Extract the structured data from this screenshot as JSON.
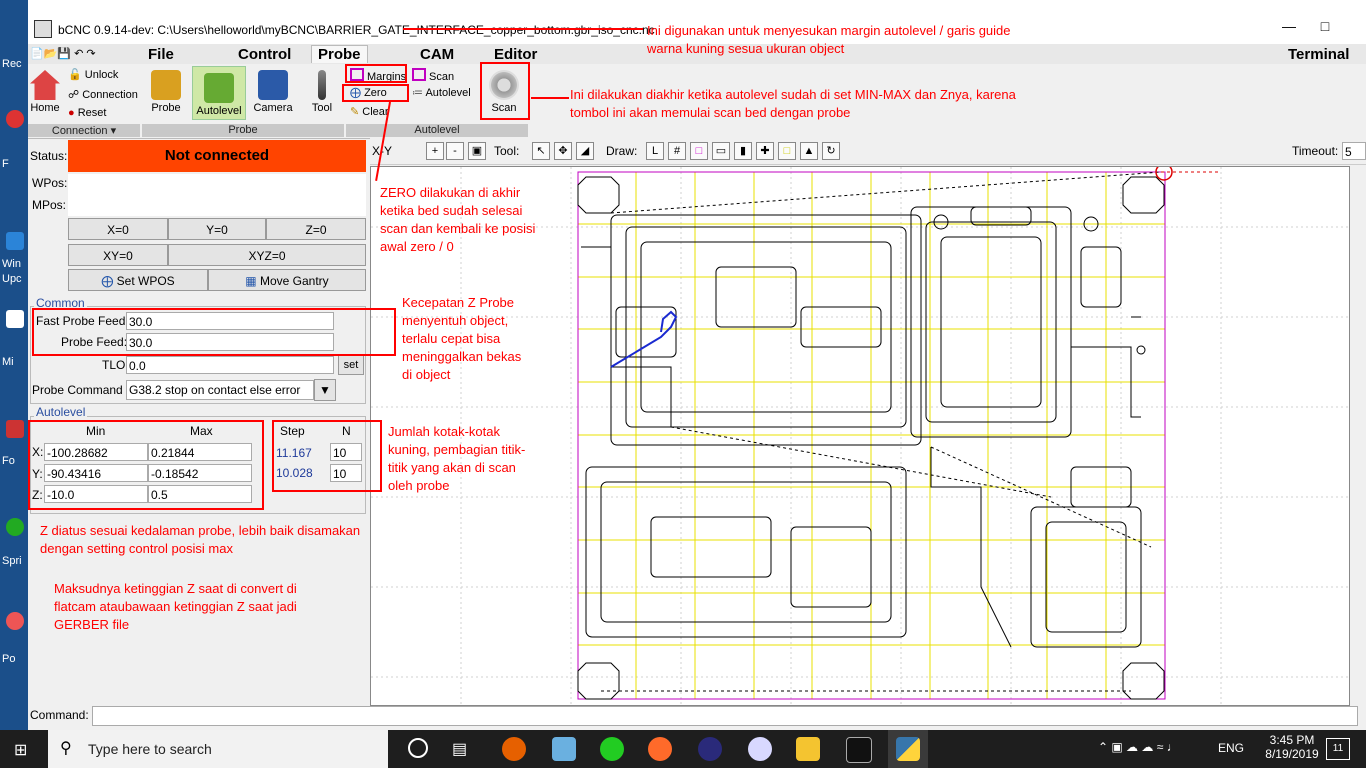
{
  "window": {
    "title": "bCNC 0.9.14-dev: C:\\Users\\helloworld\\myBCNC\\BARRIER_GATE_INTERFACE_copper_bottom.gbr_iso_cnc.nc",
    "min_icon": "minimize-icon",
    "max_icon": "maximize-icon"
  },
  "menubar": {
    "tabs": [
      "File",
      "Control",
      "Probe",
      "CAM",
      "Editor"
    ],
    "terminal": "Terminal"
  },
  "ribbon": {
    "connection": {
      "unlock": "Unlock",
      "connection": "Connection",
      "reset": "Reset",
      "home": "Home",
      "group": "Connection ▾"
    },
    "probe_group": {
      "probe": "Probe",
      "autolevel": "Autolevel",
      "camera": "Camera",
      "tool": "Tool",
      "group": "Probe"
    },
    "autolevel_group": {
      "margins": "Margins",
      "zero": "Zero",
      "clear": "Clear",
      "scan_small": "Scan",
      "autolevel_small": "Autolevel",
      "scan_big": "Scan",
      "group": "Autolevel"
    }
  },
  "left": {
    "status_label": "Status:",
    "status_value": "Not connected",
    "status_color": "#ff4400",
    "wpos_label": "WPos:",
    "mpos_label": "MPos:",
    "buttons": {
      "x0": "X=0",
      "y0": "Y=0",
      "z0": "Z=0",
      "xy0": "XY=0",
      "xyz0": "XYZ=0",
      "set_wpos": "Set WPOS",
      "move_gantry": "Move Gantry"
    },
    "common": {
      "title": "Common",
      "fast_probe_label": "Fast Probe Feed:",
      "fast_probe_value": "30.0",
      "probe_feed_label": "Probe Feed:",
      "probe_feed_value": "30.0",
      "tlo_label": "TLO",
      "tlo_value": "0.0",
      "set": "set",
      "probe_cmd_label": "Probe Command",
      "probe_cmd_value": "G38.2 stop on contact else error"
    },
    "autolevel": {
      "title": "Autolevel",
      "min": "Min",
      "max": "Max",
      "step": "Step",
      "n": "N",
      "x_label": "X:",
      "y_label": "Y:",
      "z_label": "Z:",
      "x_min": "-100.28682",
      "x_max": "0.21844",
      "y_min": "-90.43416",
      "y_max": "-0.18542",
      "z_min": "-10.0",
      "z_max": "0.5",
      "x_step": "11.167",
      "y_step": "10.028",
      "x_n": "10",
      "y_n": "10"
    },
    "command_label": "Command:"
  },
  "canvas_toolbar": {
    "view": "X-Y",
    "tool_label": "Tool:",
    "draw_label": "Draw:",
    "timeout_label": "Timeout:",
    "timeout_value": "5"
  },
  "annotations": {
    "a1": "Ini digunakan untuk menyesukan margin autolevel / garis guide",
    "a1b": "warna kuning sesua ukuran object",
    "a2": "Ini dilakukan diakhir ketika autolevel sudah di set MIN-MAX dan Znya, karena",
    "a2b": "tombol ini akan memulai scan bed dengan probe",
    "a3": [
      "ZERO dilakukan di akhir",
      "ketika bed sudah selesai",
      "scan dan kembali ke posisi",
      "awal zero / 0"
    ],
    "a4": [
      "Kecepatan Z Probe",
      "menyentuh object,",
      "terlalu cepat bisa",
      "meninggalkan bekas",
      "di object"
    ],
    "a5": [
      "Jumlah kotak-kotak",
      "kuning, pembagian titik-",
      "titik yang akan di scan",
      "oleh probe"
    ],
    "a6": [
      "Z diatus sesuai kedalaman probe, lebih baik disamakan",
      "dengan setting control posisi max"
    ],
    "a7": [
      "Maksudnya ketinggian Z saat di convert di",
      "flatcam ataubawaan ketinggian Z saat jadi",
      "GERBER file"
    ]
  },
  "desktop": {
    "labels": [
      "Rec",
      "F",
      "Win",
      "Upc",
      "Mi",
      "Fo",
      "Spri",
      "Po"
    ]
  },
  "taskbar": {
    "search_placeholder": "Type here to search",
    "lang": "ENG",
    "time": "3:45 PM",
    "date": "8/19/2019",
    "notif_count": "11"
  }
}
